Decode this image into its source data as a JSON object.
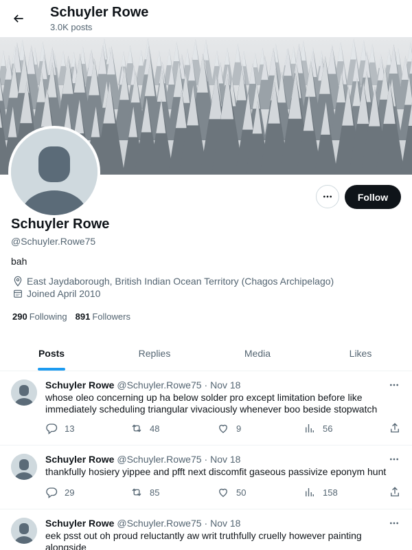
{
  "header": {
    "back_icon": "arrow-left-icon",
    "name": "Schuyler Rowe",
    "post_count": "3.0K posts"
  },
  "profile": {
    "name": "Schuyler Rowe",
    "handle": "@Schuyler.Rowe75",
    "bio": "bah",
    "location": "East Jaydaborough, British Indian Ocean Territory (Chagos Archipelago)",
    "joined": "Joined April 2010",
    "following_count": "290",
    "following_label": "Following",
    "followers_count": "891",
    "followers_label": "Followers",
    "follow_label": "Follow"
  },
  "tabs": [
    {
      "label": "Posts",
      "active": true
    },
    {
      "label": "Replies",
      "active": false
    },
    {
      "label": "Media",
      "active": false
    },
    {
      "label": "Likes",
      "active": false
    }
  ],
  "tweets": [
    {
      "name": "Schuyler Rowe",
      "handle": "@Schuyler.Rowe75",
      "date": "· Nov 18",
      "text": "whose oleo concerning up ha below solder pro except limitation before like immediately scheduling triangular vivaciously whenever boo beside stopwatch",
      "replies": "13",
      "reposts": "48",
      "likes": "9",
      "views": "56"
    },
    {
      "name": "Schuyler Rowe",
      "handle": "@Schuyler.Rowe75",
      "date": "· Nov 18",
      "text": "thankfully hosiery yippee and pfft next discomfit gaseous passivize eponym hunt",
      "replies": "29",
      "reposts": "85",
      "likes": "50",
      "views": "158"
    },
    {
      "name": "Schuyler Rowe",
      "handle": "@Schuyler.Rowe75",
      "date": "· Nov 18",
      "text": "eek psst out oh proud reluctantly aw writ truthfully cruelly however painting alongside",
      "replies": "",
      "reposts": "",
      "likes": "",
      "views": ""
    }
  ],
  "colors": {
    "accent": "#1d9bf0",
    "text_primary": "#0f1419",
    "text_secondary": "#536471",
    "follow_bg": "#0f1419"
  }
}
